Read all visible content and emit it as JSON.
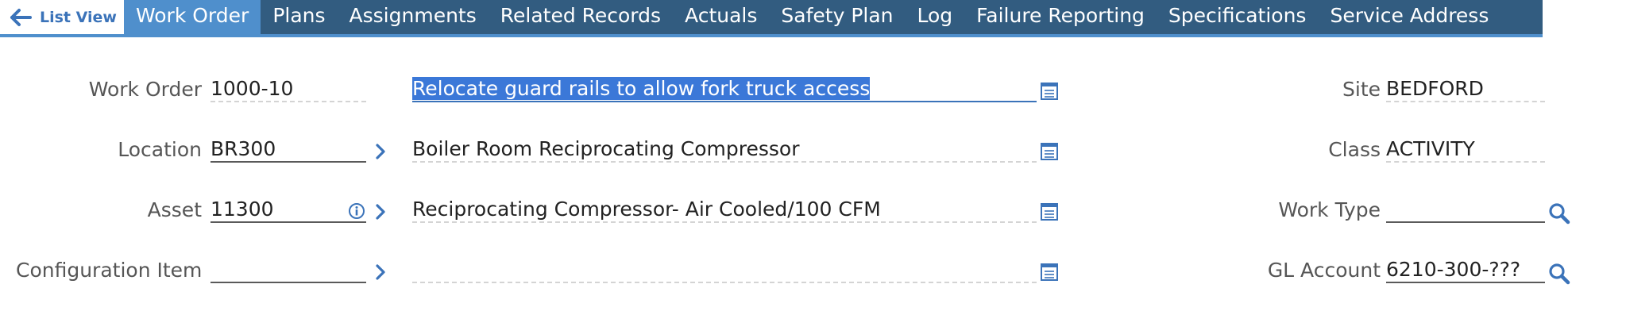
{
  "nav": {
    "list_view_label": "List View",
    "tabs": [
      "Work Order",
      "Plans",
      "Assignments",
      "Related Records",
      "Actuals",
      "Safety Plan",
      "Log",
      "Failure Reporting",
      "Specifications",
      "Service Address"
    ],
    "active_tab": "Work Order"
  },
  "form": {
    "work_order": {
      "label": "Work Order",
      "value": "1000-10",
      "description": "Relocate guard rails to allow fork truck access"
    },
    "location": {
      "label": "Location",
      "value": "BR300",
      "description": "Boiler Room Reciprocating Compressor"
    },
    "asset": {
      "label": "Asset",
      "value": "11300",
      "description": "Reciprocating Compressor- Air Cooled/100 CFM"
    },
    "config_item": {
      "label": "Configuration Item",
      "value": "",
      "description": ""
    },
    "site": {
      "label": "Site",
      "value": "BEDFORD"
    },
    "class": {
      "label": "Class",
      "value": "ACTIVITY"
    },
    "work_type": {
      "label": "Work Type",
      "value": ""
    },
    "gl_account": {
      "label": "GL Account",
      "value": "6210-300-???"
    }
  },
  "colors": {
    "tab_bar": "#325c80",
    "active_tab": "#4f8fcc",
    "accent": "#3b73b9",
    "selection": "#3b78d8"
  },
  "icons": {
    "back": "arrow-left-icon",
    "detail": "long-description-icon",
    "chevron": "chevron-right-icon",
    "info": "info-icon",
    "lookup": "search-icon"
  }
}
